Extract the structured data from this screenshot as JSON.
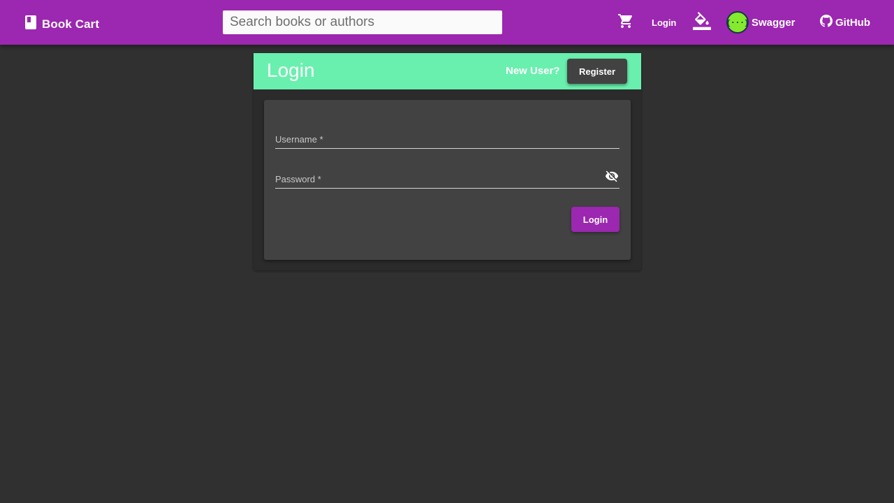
{
  "colors": {
    "primary": "#9c27b0",
    "accent": "#69f0ae",
    "background": "#303030",
    "panel": "#424242"
  },
  "header": {
    "brand": {
      "icon": "book-icon",
      "label": "Book Cart"
    },
    "search": {
      "placeholder": "Search books or authors",
      "value": ""
    },
    "nav": {
      "cart_icon": "shopping-cart-icon",
      "login_label": "Login",
      "theme_icon": "format-color-fill-icon",
      "swagger": {
        "icon": "swagger-logo",
        "logo_text": "{···}",
        "label": "Swagger"
      },
      "github": {
        "icon": "github-icon",
        "label": "GitHub"
      }
    }
  },
  "login_card": {
    "title": "Login",
    "new_user_label": "New User?",
    "register_label": "Register",
    "form": {
      "username": {
        "label": "Username *",
        "value": ""
      },
      "password": {
        "label": "Password *",
        "value": "",
        "visibility_icon": "visibility-off-icon"
      },
      "submit_label": "Login"
    }
  }
}
